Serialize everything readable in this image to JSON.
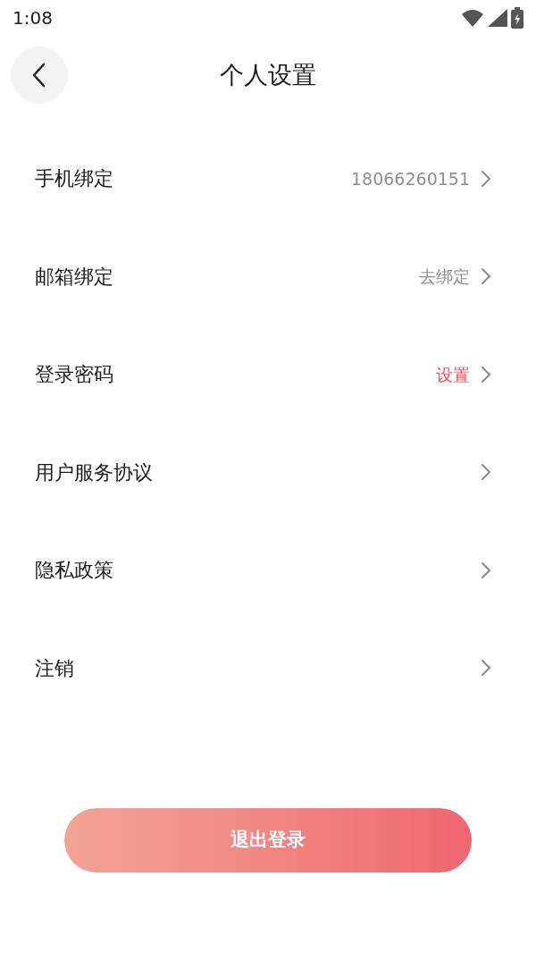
{
  "status_bar": {
    "time": "1:08"
  },
  "header": {
    "title": "个人设置"
  },
  "rows": [
    {
      "label": "手机绑定",
      "value": "18066260151",
      "kind": "muted"
    },
    {
      "label": "邮箱绑定",
      "value": "去绑定",
      "kind": "muted"
    },
    {
      "label": "登录密码",
      "value": "设置",
      "kind": "highlight"
    },
    {
      "label": "用户服务协议"
    },
    {
      "label": "隐私政策"
    },
    {
      "label": "注销"
    }
  ],
  "logout_button": {
    "label": "退出登录"
  }
}
